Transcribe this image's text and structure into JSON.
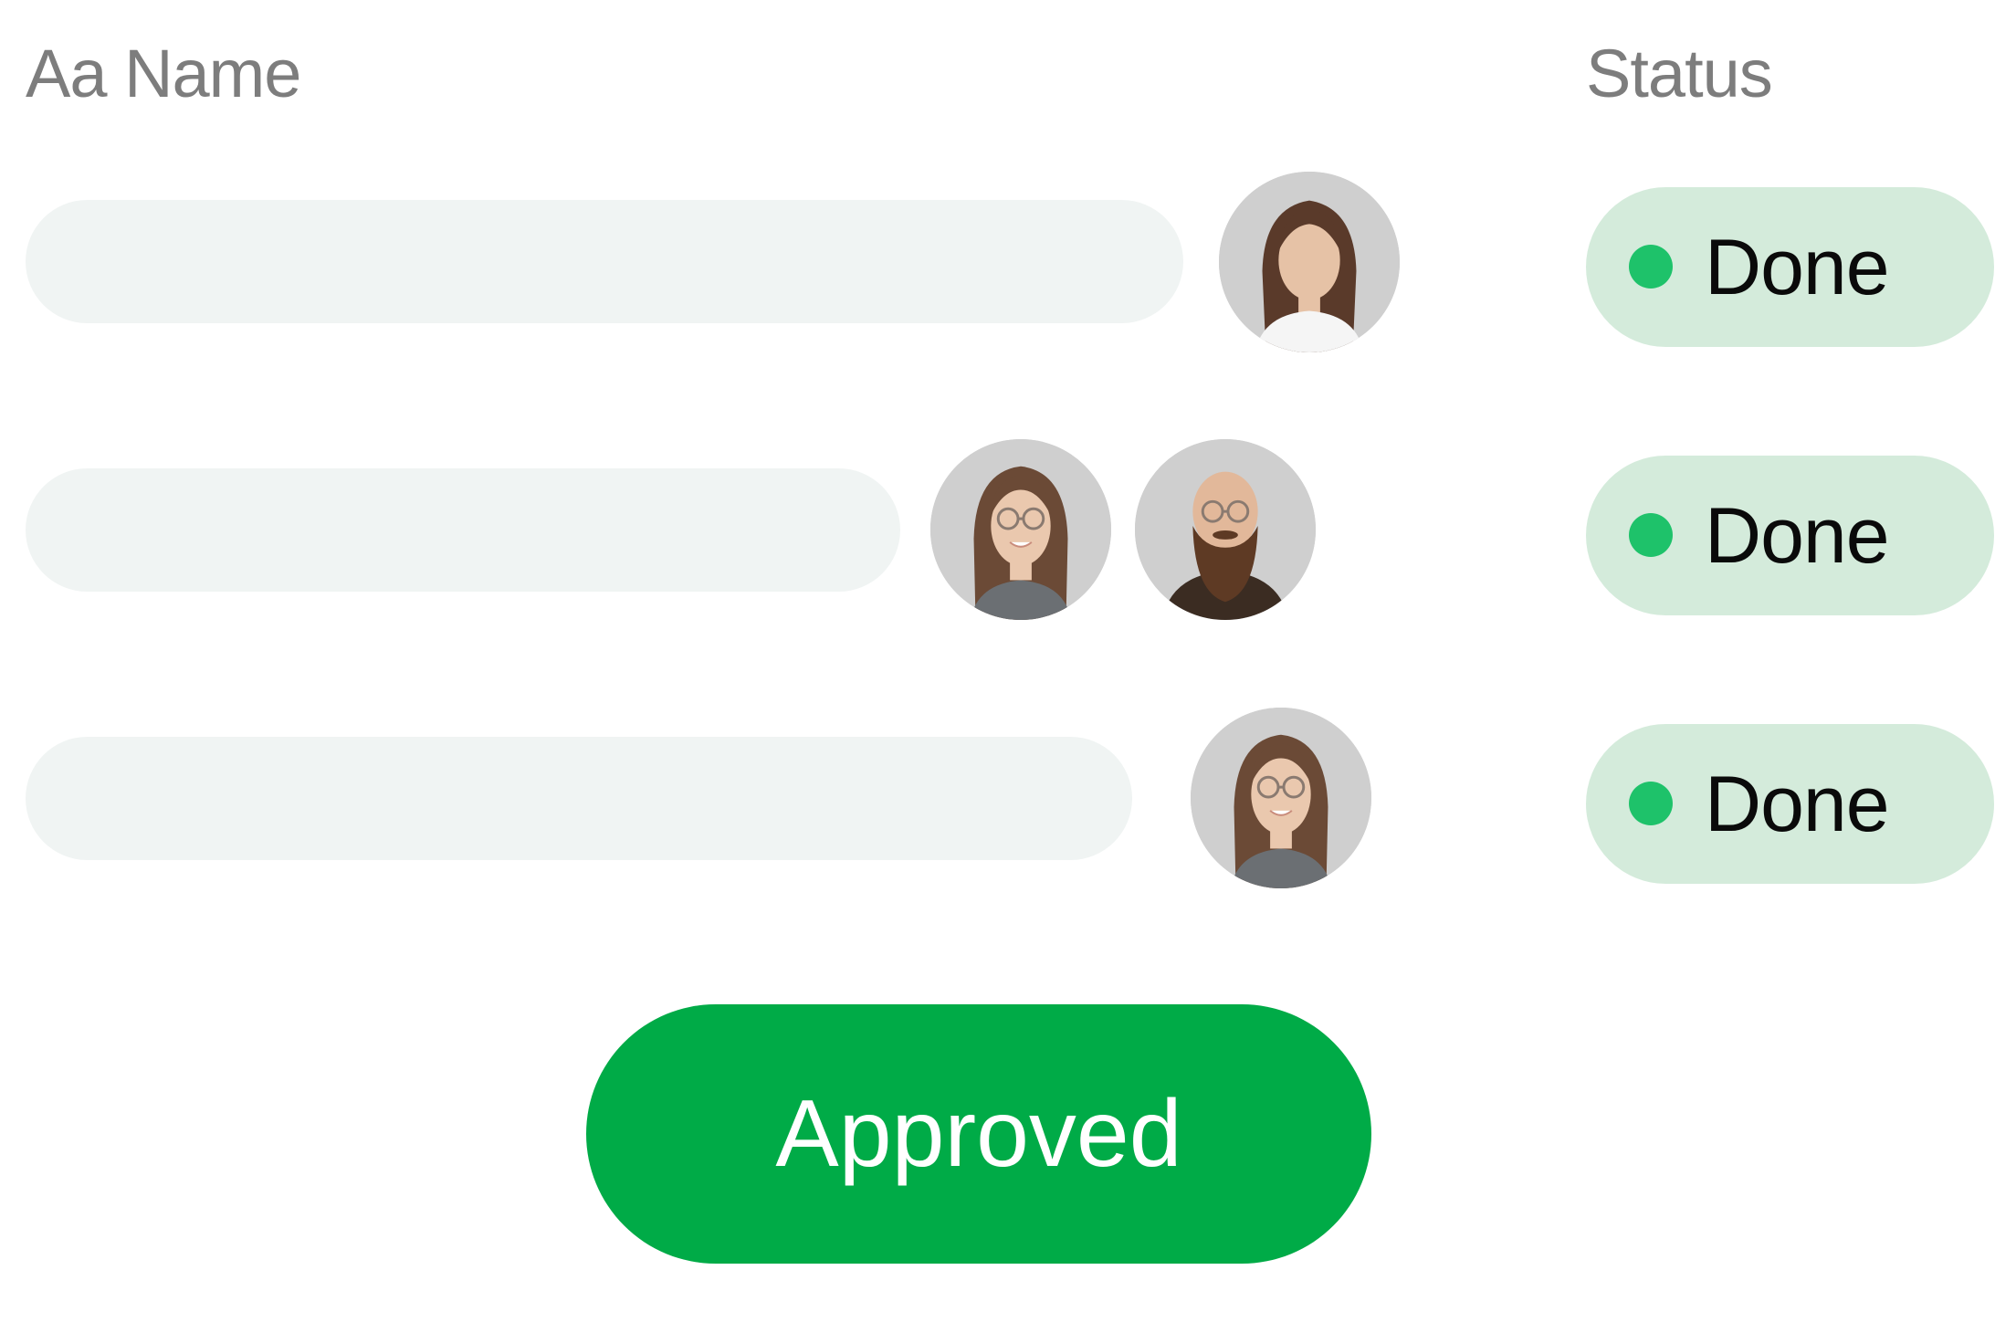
{
  "table": {
    "columns": {
      "name": "Aa Name",
      "status": "Status"
    },
    "rows": [
      {
        "assignees": [
          "avatar-woman-long-hair"
        ],
        "status": "Done"
      },
      {
        "assignees": [
          "avatar-woman-glasses",
          "avatar-bearded-man-glasses"
        ],
        "status": "Done"
      },
      {
        "assignees": [
          "avatar-woman-glasses"
        ],
        "status": "Done"
      }
    ]
  },
  "action": {
    "label": "Approved"
  },
  "colors": {
    "name_bar": "#f0f4f3",
    "status_pill_bg": "#d4ebdb",
    "status_dot": "#1ec26a",
    "button_bg": "#00ab47",
    "header_text": "#7d7d7d"
  }
}
